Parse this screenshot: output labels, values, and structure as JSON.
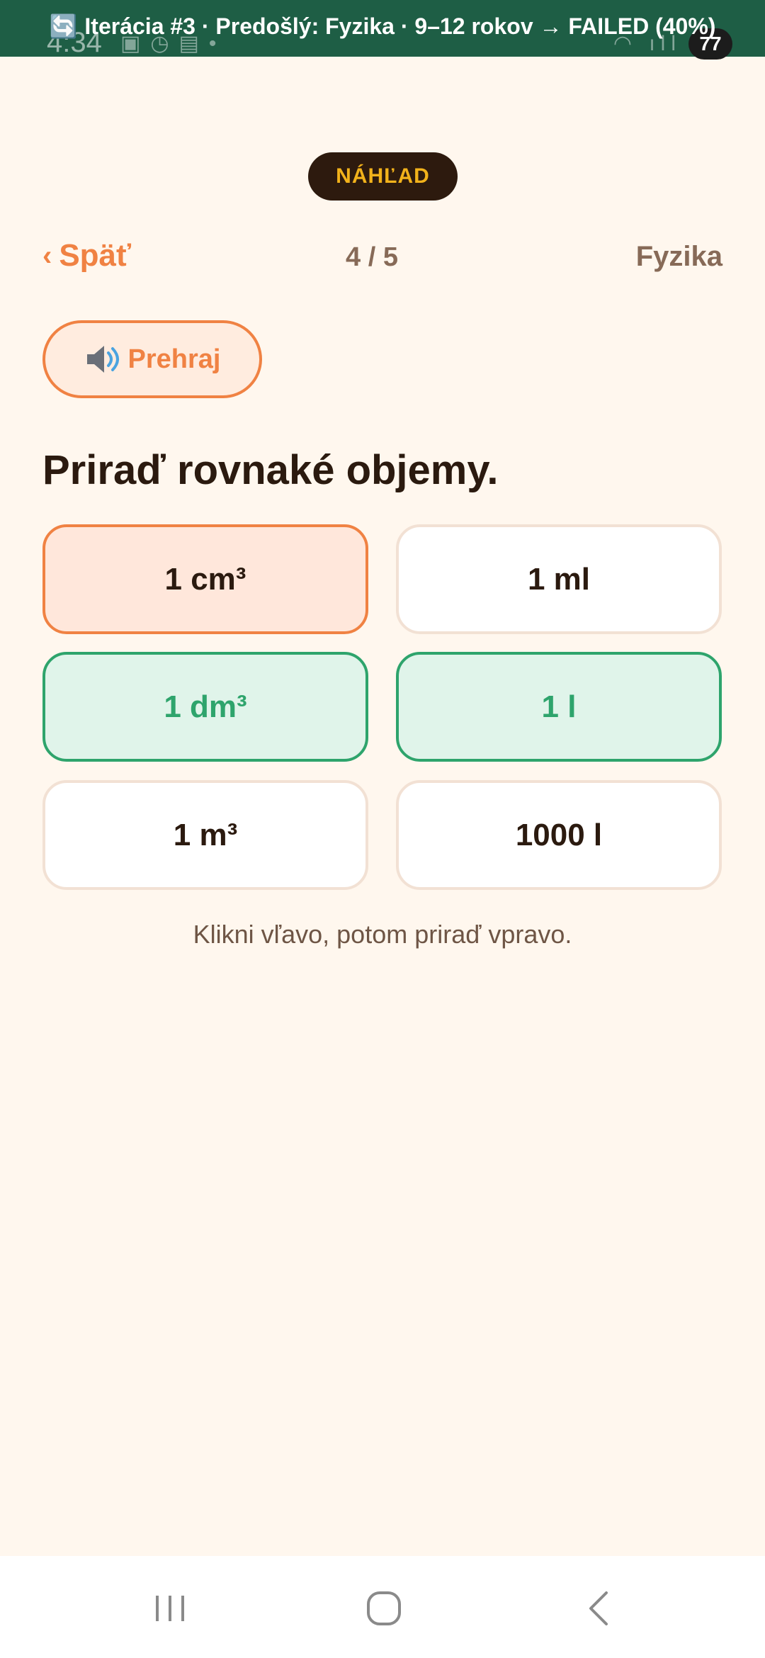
{
  "status_bar": {
    "time": "4:34",
    "battery": "77",
    "banner_icon": "🔄",
    "banner_text": "Iterácia #3 · Predošlý: Fyzika · 9–12 rokov → FAILED (40%)"
  },
  "preview_badge": "NÁHĽAD",
  "nav": {
    "back_chevron": "‹",
    "back_label": "Späť",
    "progress": "4 / 5",
    "subject": "Fyzika"
  },
  "play_button": {
    "icon": "speaker-icon",
    "label": "Prehraj"
  },
  "question": "Priraď rovnaké objemy.",
  "options": {
    "left": [
      {
        "label": "1 cm³",
        "state": "selected"
      },
      {
        "label": "1 dm³",
        "state": "matched"
      },
      {
        "label": "1 m³",
        "state": "default"
      }
    ],
    "right": [
      {
        "label": "1 ml",
        "state": "default"
      },
      {
        "label": "1 l",
        "state": "matched"
      },
      {
        "label": "1000 l",
        "state": "default"
      }
    ]
  },
  "hint": "Klikni vľavo, potom priraď vpravo.",
  "colors": {
    "background": "#FFF7EE",
    "accent": "#F08243",
    "success": "#2EA46C",
    "banner": "#1E5E45",
    "preview_pill": "#2D1A0E",
    "preview_text": "#F2B21B"
  }
}
